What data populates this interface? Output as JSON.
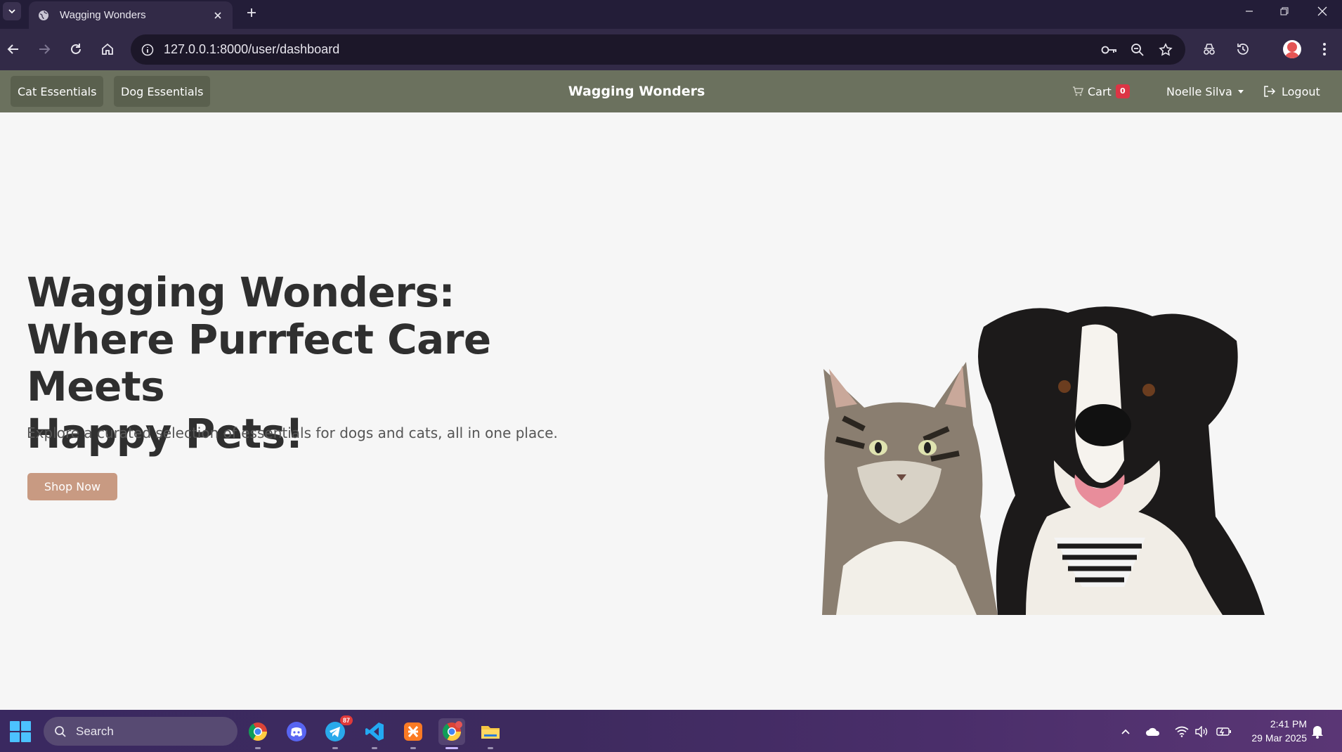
{
  "browser": {
    "tab_title": "Wagging Wonders",
    "url": "127.0.0.1:8000/user/dashboard"
  },
  "site": {
    "nav": {
      "cat_label": "Cat Essentials",
      "dog_label": "Dog Essentials",
      "brand": "Wagging Wonders",
      "cart_label": "Cart",
      "cart_count": "0",
      "user_name": "Noelle Silva",
      "logout_label": "Logout"
    },
    "hero": {
      "title_line1": "Wagging Wonders:",
      "title_line2": "Where Purrfect Care Meets",
      "title_line3": "Happy Pets!",
      "subtitle": "Explore a curated selection of essentials for dogs and cats, all in one place.",
      "cta_label": "Shop Now"
    }
  },
  "taskbar": {
    "search_placeholder": "Search",
    "telegram_badge": "87",
    "time": "2:41 PM",
    "date": "29 Mar 2025"
  },
  "colors": {
    "navbar_bg": "#6b715e",
    "cta_bg": "#c89a82",
    "badge_bg": "#dc3545",
    "page_bg": "#f6f6f6"
  }
}
